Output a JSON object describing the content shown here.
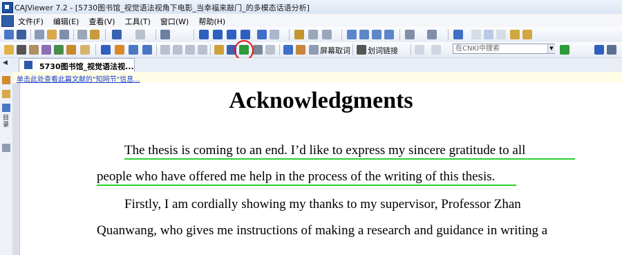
{
  "window": {
    "title": "CAJViewer 7.2 - [5730图书馆_视觉语法视角下电影_当幸福来敲门_的多模态话语分析]"
  },
  "menu": [
    "文件(F)",
    "编辑(E)",
    "查看(V)",
    "工具(T)",
    "窗口(W)",
    "帮助(H)"
  ],
  "toolbar": {
    "capture_text_label": "屏幕取词",
    "link_label": "划词链接",
    "search_placeholder": "在CNKI中搜索"
  },
  "tabs": {
    "doc_tab_label": "5730图书馆_视觉语法视..."
  },
  "sidebar": {
    "toc_label": "目录"
  },
  "infobar": {
    "link_text": "单击此处查看此篇文献的\"知网节\"信息..."
  },
  "document": {
    "title": "Acknowledgments",
    "lines": [
      "The thesis is coming to an end. I’d like to express my sincere gratitude to all",
      "people who have offered me help in the process of the writing of this thesis.",
      "Firstly, I am cordially showing my thanks to my supervisor, Professor Zhan",
      "Quanwang, who gives me instructions of making a research and guidance in writing a"
    ]
  },
  "colors": {
    "highlight_underline": "#2ad12a",
    "annotation_circle": "#e01515"
  }
}
